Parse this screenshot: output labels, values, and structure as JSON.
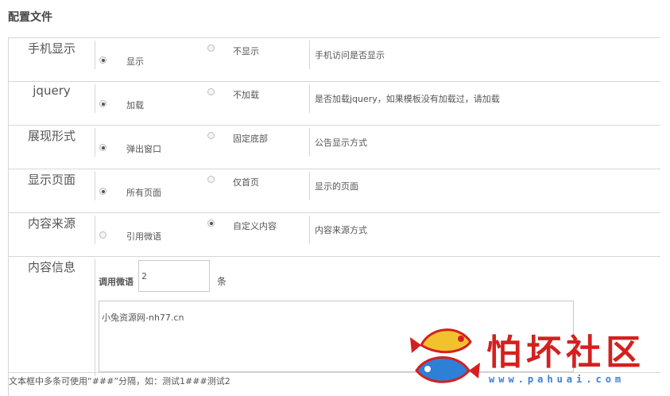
{
  "page": {
    "title": "配置文件"
  },
  "rows": [
    {
      "label": "手机显示",
      "options": [
        {
          "label": "显示",
          "checked": true
        },
        {
          "label": "不显示",
          "checked": false
        }
      ],
      "description": "手机访问是否显示"
    },
    {
      "label": "jquery",
      "options": [
        {
          "label": "加载",
          "checked": true
        },
        {
          "label": "不加载",
          "checked": false
        }
      ],
      "description": "是否加载jquery，如果模板没有加载过，请加载"
    },
    {
      "label": "展现形式",
      "options": [
        {
          "label": "弹出窗口",
          "checked": true
        },
        {
          "label": "固定底部",
          "checked": false
        }
      ],
      "description": "公告显示方式"
    },
    {
      "label": "显示页面",
      "options": [
        {
          "label": "所有页面",
          "checked": true
        },
        {
          "label": "仅首页",
          "checked": false
        }
      ],
      "description": "显示的页面"
    },
    {
      "label": "内容来源",
      "options": [
        {
          "label": "引用微语",
          "checked": false
        },
        {
          "label": "自定义内容",
          "checked": true
        }
      ],
      "description": "内容来源方式"
    }
  ],
  "content_info": {
    "label": "内容信息",
    "count_label": "调用微语",
    "count_value": "2",
    "count_unit": "条",
    "content_value": "小兔资源网-nh77.cn",
    "hint": "文本框中多条可使用“###”分隔，如：测试1###测试2"
  },
  "watermark": {
    "text": "怕坏社区",
    "url": "www.pahuai.com"
  }
}
